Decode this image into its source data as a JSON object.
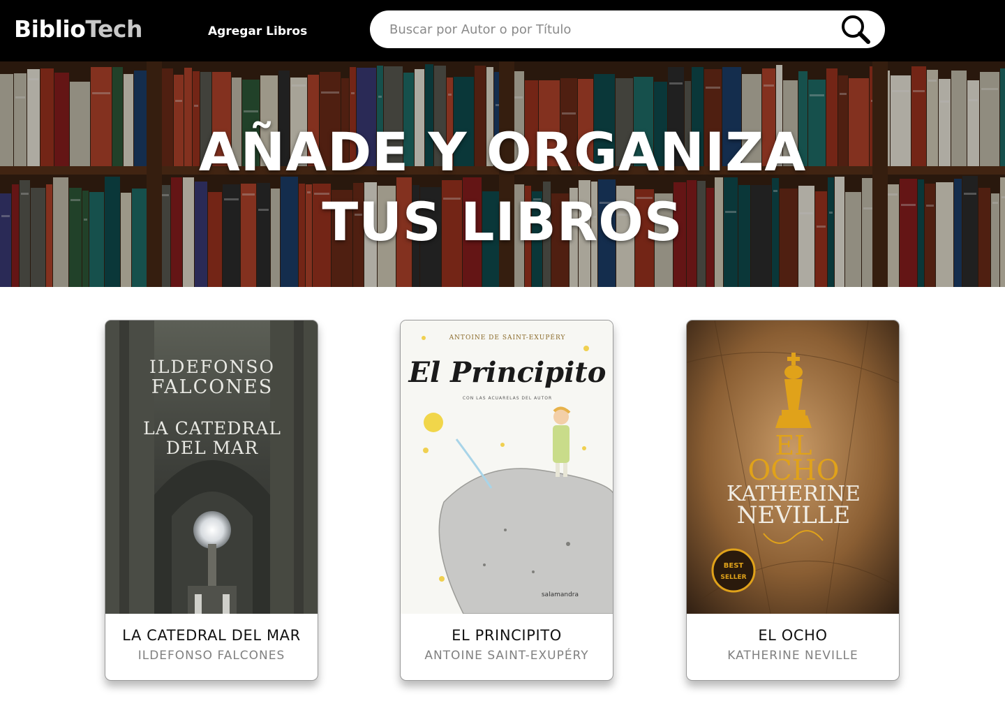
{
  "brand": {
    "part1": "Biblio",
    "part2": "Tech"
  },
  "nav": {
    "add_books": "Agregar Libros"
  },
  "search": {
    "placeholder": "Buscar por Autor o por Título",
    "value": "",
    "icon": "magnifier-icon"
  },
  "hero": {
    "line1": "AÑADE Y ORGANIZA",
    "line2": "TUS LIBROS"
  },
  "books": [
    {
      "title": "LA CATEDRAL DEL MAR",
      "author": "ILDEFONSO FALCONES",
      "cover": {
        "author_line1": "ILDEFONSO",
        "author_line2": "FALCONES",
        "title_line1": "LA CATEDRAL",
        "title_line2": "DEL MAR"
      }
    },
    {
      "title": "EL PRINCIPITO",
      "author": "ANTOINE SAINT-EXUPÉRY",
      "cover": {
        "top": "ANTOINE DE SAINT-EXUPÉRY",
        "title": "El Principito",
        "sub": "CON LAS ACUARELAS DEL AUTOR",
        "publisher": "salamandra"
      }
    },
    {
      "title": "EL OCHO",
      "author": "KATHERINE NEVILLE",
      "cover": {
        "title_line1": "EL",
        "title_line2": "OCHO",
        "author_line1": "KATHERINE",
        "author_line2": "NEVILLE",
        "badge_line1": "BEST",
        "badge_line2": "SELLER"
      }
    }
  ],
  "colors": {
    "topbar": "#000000",
    "accent_gold": "#e0a21a",
    "card_border": "#9a9a9a"
  }
}
